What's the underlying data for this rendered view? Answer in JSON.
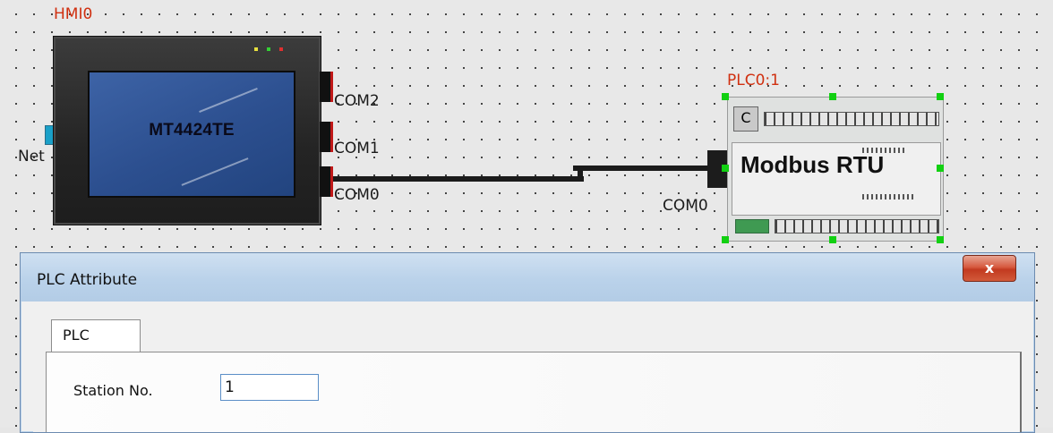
{
  "canvas": {
    "hmi": {
      "name": "HMI0",
      "model": "MT4424TE",
      "net_label": "Net",
      "ports": [
        "COM2",
        "COM1",
        "COM0"
      ]
    },
    "plc": {
      "name": "PLC0:1",
      "protocol_label": "Modbus RTU",
      "port_label": "COM0"
    }
  },
  "dialog": {
    "title": "PLC Attribute",
    "close_label": "x",
    "tabs": [
      {
        "label": "PLC"
      }
    ],
    "station_label": "Station No.",
    "station_value": "1"
  },
  "colors": {
    "label_red": "#d03010",
    "selection_green": "#12d012",
    "hmi_screen_blue": "#2c4f8f"
  },
  "icons": [
    "net-icon",
    "close-icon"
  ]
}
